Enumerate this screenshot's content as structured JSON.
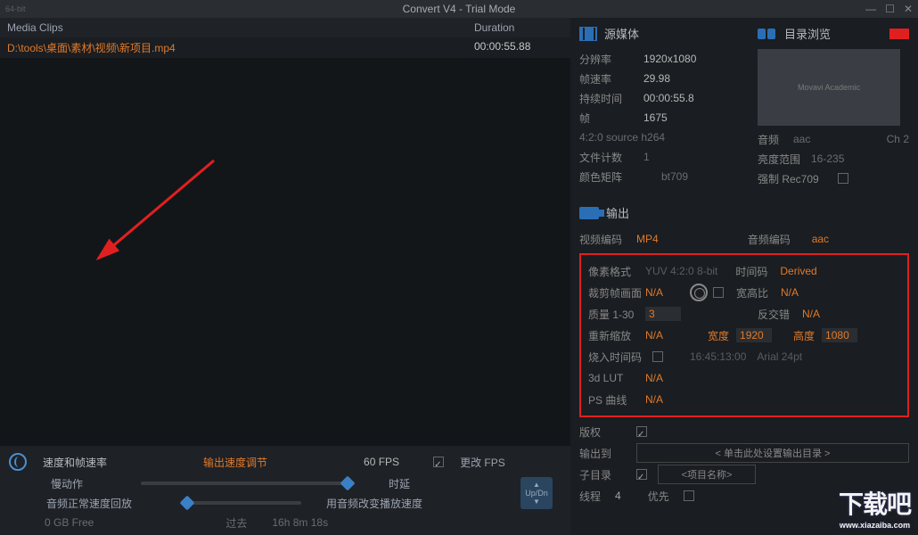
{
  "title": "Convert V4 - Trial Mode",
  "bitbadge": "64-bit",
  "list": {
    "head_clips": "Media Clips",
    "head_duration": "Duration",
    "row_path": "D:\\tools\\桌面\\素材\\视频\\新项目.mp4",
    "row_dur": "00:00:55.88"
  },
  "source": {
    "title": "源媒体",
    "browse": "目录浏览",
    "res_lbl": "分辨率",
    "res_val": "1920x1080",
    "fps_lbl": "帧速率",
    "fps_val": "29.98",
    "dur_lbl": "持续时间",
    "dur_val": "00:00:55.8",
    "frames_lbl": "帧",
    "frames_val": "1675",
    "src_fmt": "4:2:0 source  h264",
    "files_lbl": "文件计数",
    "files_val": "1",
    "matrix_lbl": "颜色矩阵",
    "matrix_val": "bt709",
    "audio_lbl": "音频",
    "audio_val": "aac",
    "audio_ch": "Ch 2",
    "range_lbl": "亮度范围",
    "range_val": "16-235",
    "force_lbl": "强制 Rec709",
    "thumb_text": "Movavi Academic"
  },
  "output": {
    "title": "输出",
    "venc_lbl": "视频编码",
    "venc_val": "MP4",
    "aenc_lbl": "音频编码",
    "aenc_val": "aac",
    "pix_lbl": "像素格式",
    "pix_val": "YUV 4:2:0 8-bit",
    "tc_lbl": "时间码",
    "tc_val": "Derived",
    "crop_lbl": "裁剪帧画面",
    "crop_val": "N/A",
    "ar_lbl": "宽高比",
    "ar_val": "N/A",
    "qual_lbl": "质量 1-30",
    "qual_val": "3",
    "deint_lbl": "反交错",
    "deint_val": "N/A",
    "rescale_lbl": "重新缩放",
    "rescale_val": "N/A",
    "w_lbl": "宽度",
    "w_val": "1920",
    "h_lbl": "高度",
    "h_val": "1080",
    "burn_lbl": "烧入时间码",
    "burn_tc": "16:45:13:00",
    "burn_font": "Arial 24pt",
    "lut_lbl": "3d LUT",
    "lut_val": "N/A",
    "ps_lbl": "PS 曲线",
    "ps_val": "N/A"
  },
  "dest": {
    "copyright_lbl": "版权",
    "outto_lbl": "输出到",
    "outto_val": "< 单击此处设置输出目录 >",
    "subdir_lbl": "子目录",
    "subdir_val": "<项目名称>",
    "threads_lbl": "线程",
    "threads_val": "4",
    "prio_lbl": "优先"
  },
  "speed": {
    "title": "速度和帧速率",
    "outspeed_lbl": "输出速度调节",
    "fps_val": "60 FPS",
    "change_fps": "更改 FPS",
    "slomo": "慢动作",
    "delay": "时延",
    "normal": "音频正常速度回放",
    "chgspeed": "用音频改变播放速度",
    "free": "0 GB Free",
    "past_lbl": "过去",
    "past_val": "16h 8m 18s",
    "updn": "Up/Dn"
  },
  "watermark": "下载吧",
  "watermark_url": "www.xiazaiba.com"
}
